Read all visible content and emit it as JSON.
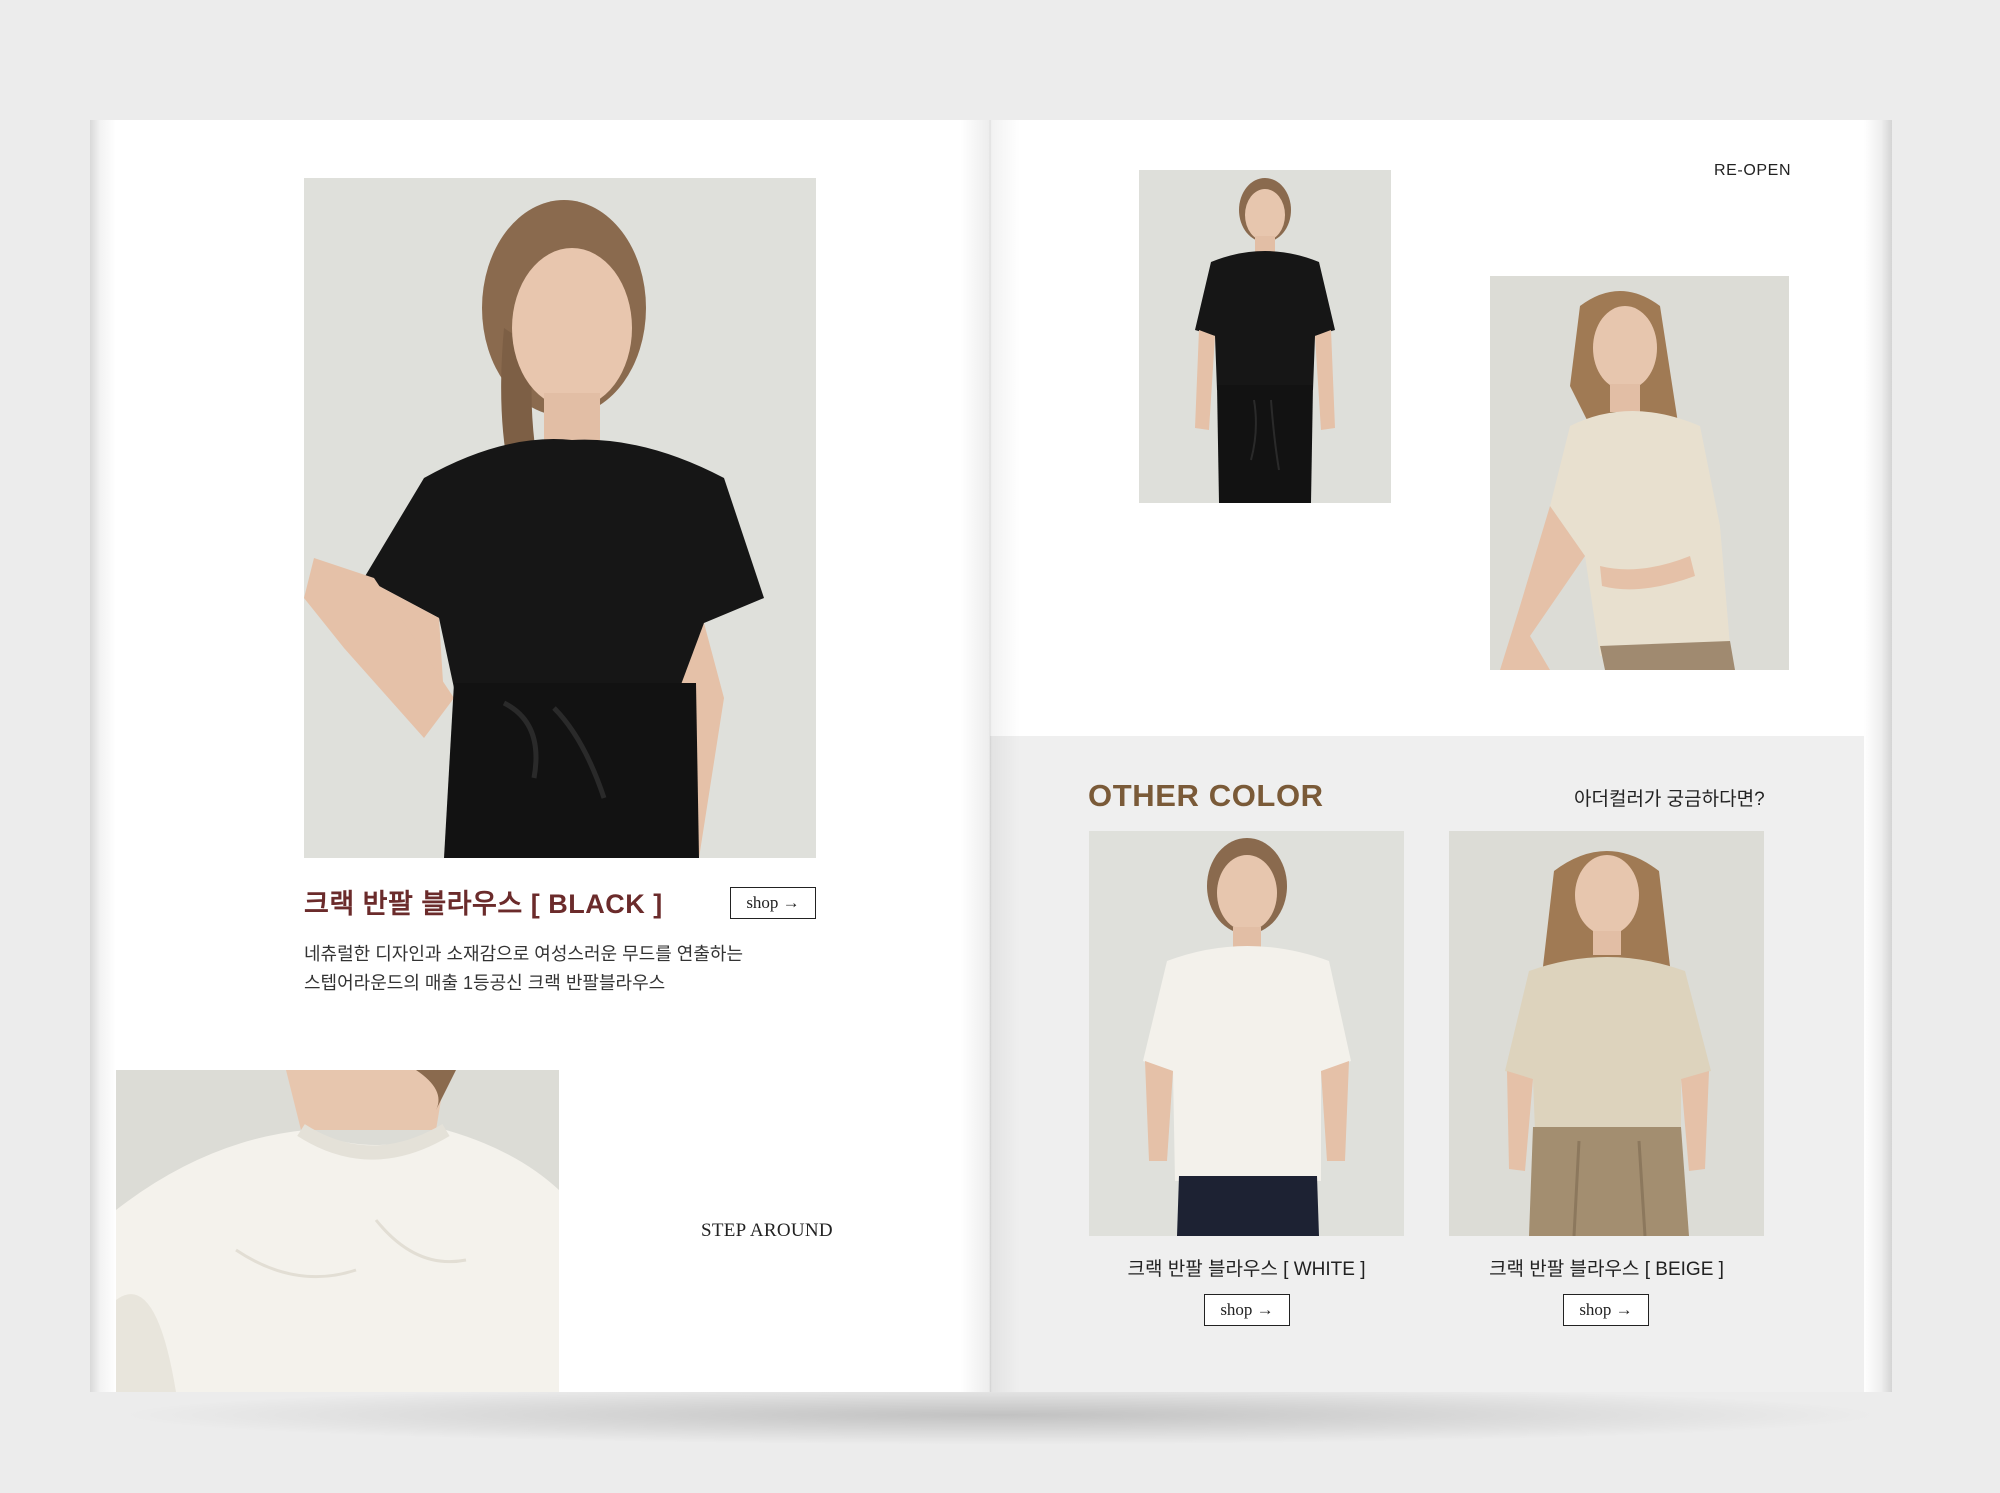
{
  "left_page": {
    "product_title": "크랙 반팔 블라우스 [ BLACK ]",
    "shop_label": "shop →",
    "description_line1": "네츄럴한 디자인과 소재감으로 여성스러운 무드를 연출하는",
    "description_line2": "스텝어라운드의 매출 1등공신 크랙 반팔블라우스",
    "brand_text": "STEP AROUND"
  },
  "right_page": {
    "corner_label": "RE-OPEN",
    "other_color": {
      "title": "OTHER COLOR",
      "question": "아더컬러가 궁금하다면?",
      "products": [
        {
          "label": "크랙 반팔 블라우스 [ WHITE ]",
          "shop_label": "shop →"
        },
        {
          "label": "크랙 반팔 블라우스 [ BEIGE ]",
          "shop_label": "shop →"
        }
      ]
    }
  },
  "colors": {
    "title_accent": "#6b2b2b",
    "other_color_accent": "#7a5a38",
    "panel_background": "#efefef"
  }
}
